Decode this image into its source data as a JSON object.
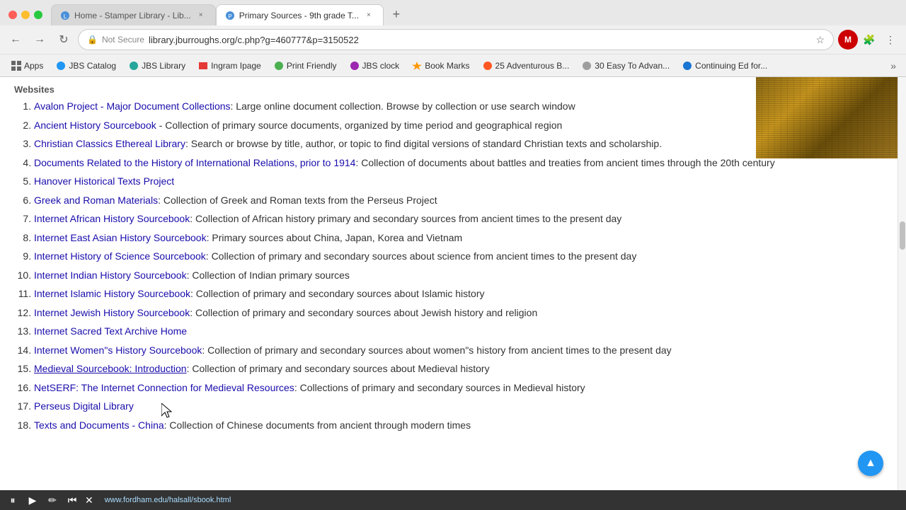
{
  "browser": {
    "traffic_lights": [
      "red",
      "yellow",
      "green"
    ],
    "tabs": [
      {
        "id": "tab1",
        "title": "Home - Stamper Library - Lib...",
        "active": false,
        "favicon_color": "#4a90d9"
      },
      {
        "id": "tab2",
        "title": "Primary Sources - 9th grade T...",
        "active": true,
        "favicon_color": "#4a90d9"
      }
    ],
    "new_tab_label": "+",
    "nav": {
      "back_disabled": false,
      "forward_disabled": false
    },
    "address_bar": {
      "security_label": "Not Secure",
      "url": "library.jburroughs.org/c.php?g=460777&p=3150522"
    },
    "bookmarks": [
      {
        "id": "apps",
        "label": "Apps",
        "favicon": "grid"
      },
      {
        "id": "jbs-catalog",
        "label": "JBS Catalog",
        "favicon": "circle-blue"
      },
      {
        "id": "jbs-library",
        "label": "JBS Library",
        "favicon": "circle-teal"
      },
      {
        "id": "ingram",
        "label": "Ingram Ipage",
        "favicon": "rect-red"
      },
      {
        "id": "print-friendly",
        "label": "Print Friendly",
        "favicon": "circle-green"
      },
      {
        "id": "jbs-clock",
        "label": "JBS clock",
        "favicon": "circle-purple"
      },
      {
        "id": "bookmarks",
        "label": "Book Marks",
        "favicon": "star"
      },
      {
        "id": "25adv",
        "label": "25 Adventurous B...",
        "favicon": "circle-orange"
      },
      {
        "id": "30easy",
        "label": "30 Easy To Advan...",
        "favicon": "circle-gray"
      },
      {
        "id": "contEd",
        "label": "Continuing Ed for...",
        "favicon": "circle-blue2"
      }
    ],
    "more_label": "»"
  },
  "page": {
    "section_label": "Websites",
    "items": [
      {
        "num": 1,
        "link_text": "Avalon Project - Major Document Collections",
        "link_url": "#",
        "description": ": Large online document collection. Browse by collection or use search window"
      },
      {
        "num": 2,
        "link_text": "Ancient History Sourcebook",
        "link_url": "#",
        "description": " - Collection of primary source documents, organized by time period and geographical region"
      },
      {
        "num": 3,
        "link_text": "Christian Classics Ethereal Library",
        "link_url": "#",
        "description": ": Search or browse by title, author, or topic to find digital versions of standard Christian texts and scholarship."
      },
      {
        "num": 4,
        "link_text": "Documents Related to the History of International Relations, prior to 1914",
        "link_url": "#",
        "description": ": Collection of documents about battles and treaties from ancient times through the 20th century"
      },
      {
        "num": 5,
        "link_text": "Hanover Historical Texts Project",
        "link_url": "#",
        "description": ""
      },
      {
        "num": 6,
        "link_text": "Greek and Roman Materials",
        "link_url": "#",
        "description": ": Collection of Greek and Roman texts from the Perseus Project"
      },
      {
        "num": 7,
        "link_text": "Internet African History Sourcebook",
        "link_url": "#",
        "description": ": Collection of African history primary and secondary sources from ancient times to the present day"
      },
      {
        "num": 8,
        "link_text": "Internet East Asian History Sourcebook",
        "link_url": "#",
        "description": ": Primary sources about China, Japan, Korea and Vietnam"
      },
      {
        "num": 9,
        "link_text": "Internet History of Science Sourcebook",
        "link_url": "#",
        "description": ": Collection of primary and secondary sources about science from ancient times to the present day"
      },
      {
        "num": 10,
        "link_text": "Internet Indian History Sourcebook",
        "link_url": "#",
        "description": ": Collection of Indian primary sources"
      },
      {
        "num": 11,
        "link_text": "Internet Islamic History Sourcebook",
        "link_url": "#",
        "description": ": Collection of primary and secondary sources about Islamic history"
      },
      {
        "num": 12,
        "link_text": "Internet Jewish History Sourcebook",
        "link_url": "#",
        "description": ": Collection of primary and secondary sources about Jewish history and religion"
      },
      {
        "num": 13,
        "link_text": "Internet Sacred Text Archive Home",
        "link_url": "#",
        "description": ""
      },
      {
        "num": 14,
        "link_text": "Internet Women\"s History Sourcebook",
        "link_url": "#",
        "description": ": Collection of primary and secondary sources about women\"s history from ancient times to the present day"
      },
      {
        "num": 15,
        "link_text": "Medieval Sourcebook: Introduction",
        "link_url": "#",
        "description": ": Collection of primary and secondary sources about Medieval history",
        "hovered": true
      },
      {
        "num": 16,
        "link_text": "NetSERF: The Internet Connection for Medieval Resources",
        "link_url": "#",
        "description": ": Collections of primary and secondary sources in Medieval history"
      },
      {
        "num": 17,
        "link_text": "Perseus Digital Library",
        "link_url": "#",
        "description": ""
      },
      {
        "num": 18,
        "link_text": "Texts and Documents - China",
        "link_url": "#",
        "description": ": Collection of Chinese documents from ancient through modern times"
      }
    ]
  },
  "media_bar": {
    "url": "www.fordham.edu/halsall/sbook.html",
    "buttons": [
      "pause",
      "play",
      "edit",
      "rewind",
      "close"
    ]
  },
  "back_to_top": "▲"
}
